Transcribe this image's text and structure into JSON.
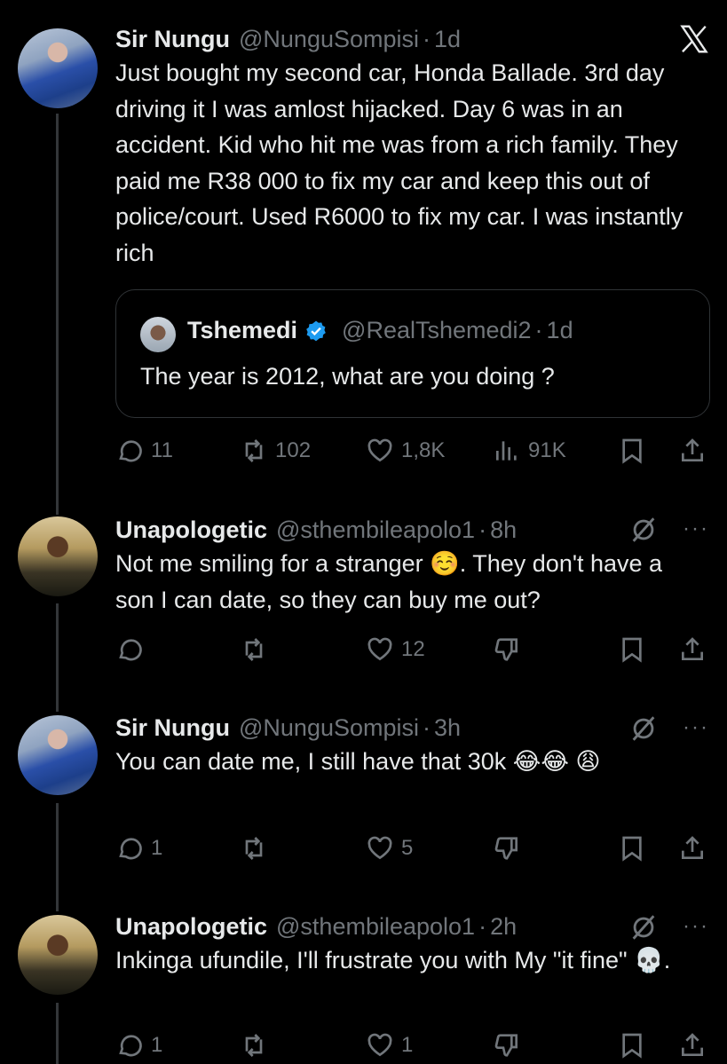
{
  "tweets": [
    {
      "name": "Sir Nungu",
      "handle": "@NunguSompisi",
      "time": "1d",
      "text": "Just bought my second car, Honda Ballade. 3rd day  driving it  I was amlost hijacked. Day 6 was in an accident. Kid who hit me was from a rich family. They paid me R38 000 to fix my car and keep this out of police/court. Used R6000 to fix my car. I was instantly rich",
      "quote": {
        "name": "Tshemedi",
        "handle": "@RealTshemedi2",
        "time": "1d",
        "text": "The year is 2012, what are you doing ?"
      },
      "replies": "11",
      "reposts": "102",
      "likes": "1,8K",
      "views": "91K"
    },
    {
      "name": "Unapologetic",
      "handle": "@sthembileapolo1",
      "time": "8h",
      "text": "Not me smiling for a stranger ☺️. They don't have a son I can date, so they can buy me out?",
      "replies": "",
      "reposts": "",
      "likes": "12"
    },
    {
      "name": "Sir Nungu",
      "handle": "@NunguSompisi",
      "time": "3h",
      "text": "You can date me, I still have that 30k 😂😂 😩",
      "replies": "1",
      "reposts": "",
      "likes": "5"
    },
    {
      "name": "Unapologetic",
      "handle": "@sthembileapolo1",
      "time": "2h",
      "text": "Inkinga ufundile, I'll frustrate you with My \"it fine\" 💀.",
      "replies": "1",
      "reposts": "",
      "likes": "1"
    }
  ],
  "separator": "·",
  "more_label": "···",
  "icons": [
    "x-logo-icon",
    "grok-icon",
    "more-icon",
    "reply-icon",
    "repost-icon",
    "like-icon",
    "views-icon",
    "dislike-icon",
    "bookmark-icon",
    "share-icon",
    "verified-icon"
  ],
  "colors": {
    "background": "#000000",
    "text": "#e7e9ea",
    "muted": "#71767b",
    "verified": "#1d9bf0",
    "border": "#2f3336"
  }
}
